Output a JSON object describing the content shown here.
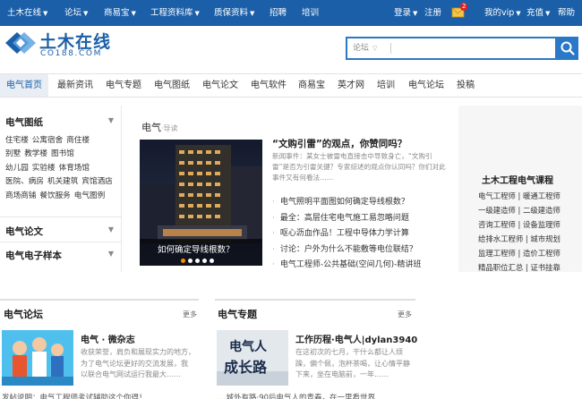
{
  "topbar": {
    "left": [
      "土木在线",
      "论坛",
      "商易宝",
      "工程资料库",
      "质保资料",
      "招聘",
      "培训"
    ],
    "login": "登录",
    "register": "注册",
    "badge": "2",
    "vip": "我的vip",
    "recharge": "充值",
    "help": "帮助"
  },
  "logo": {
    "cn": "土木在线",
    "en": "CO188.COM"
  },
  "search": {
    "scope": "论坛",
    "value": ""
  },
  "nav": [
    "电气首页",
    "最新资讯",
    "电气专题",
    "电气图纸",
    "电气论文",
    "电气软件",
    "商易宝",
    "英才网",
    "培训",
    "电气论坛",
    "投稿"
  ],
  "sidebar": {
    "heading1": "电气图纸",
    "rows": [
      [
        "住宅楼",
        "公寓宿舍",
        "商住楼"
      ],
      [
        "别墅",
        "教学楼",
        "图书馆"
      ],
      [
        "幼儿园",
        "实验楼",
        "体育场馆"
      ],
      [
        "医院、病房",
        "机关建筑",
        "宾馆酒店"
      ],
      [
        "商场商铺",
        "餐饮服务",
        "电气图例"
      ]
    ],
    "heading2": "电气论文",
    "heading3": "电气电子样本"
  },
  "section": {
    "title": "电气",
    "sub": "·导读"
  },
  "feature": {
    "caption": "如何确定导线根数？"
  },
  "lead": {
    "title": "“文购引雷”的观点，你赞同吗？",
    "desc": "新闻事件：某女士被雷电直接击中导致身亡，“文购引雷”是否为引雷关键？专家综述的观点你认同吗？你们对此事件又有何看法……"
  },
  "articles": [
    "电气照明平面图如何确定导线根数？",
    "最全：高层住宅电气施工易忽略问题",
    "呕心沥血作品！工程中导体力学计算",
    "讨论：户外为什么不能敷等电位联结？",
    "电气工程师-公共基础(空间几何)-精讲班"
  ],
  "right": {
    "title": "土木工程电气课程",
    "links": [
      "电气工程师 | 暖通工程师",
      "一级建造师 | 二级建造师",
      "咨询工程师 | 设备监理师",
      "给排水工程师 | 城市规划",
      "监理工程师 | 造价工程师",
      "精品职位汇总 | 证书挂靠"
    ]
  },
  "panel1": {
    "title": "电气论坛",
    "more": "更多",
    "item_title": "电气 · 微杂志",
    "item_desc": [
      "收获荣誉，肩负和展现实力的地方，",
      "为了电气论坛更好的交流发展，我",
      "以联合电气网试运行我最大……"
    ],
    "cut": "发帖说明：电气工程师考试辅助这个你得！"
  },
  "panel2": {
    "title": "电气专题",
    "more": "更多",
    "thumb_text": [
      "电气人",
      "成长路"
    ],
    "item_title": "工作历程·电气人|dylan3940",
    "item_desc": [
      "在这初次的七月，干什么都让人烦",
      "躁，偏个佩，泡杯茶喝，让心情平静",
      "下来，坐在电脑前，一年……"
    ],
    "cut": "…城外有路·90后电气人的青春，在一里看世界"
  },
  "colors": {
    "brand": "#1b5fa8",
    "accent": "#2a78c8",
    "active_dot": "#ff8a00"
  }
}
